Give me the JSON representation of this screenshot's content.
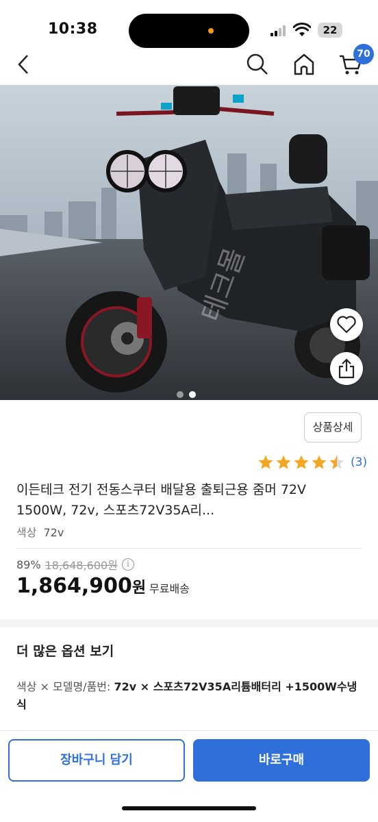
{
  "status_bar": {
    "time": "10:38",
    "battery": "22"
  },
  "nav": {
    "cart_count": "70"
  },
  "hero": {
    "watermark": "테크몰",
    "slide_count": 2,
    "active_slide": 2
  },
  "product": {
    "detail_button": "상품상세",
    "rating_stars": 4.5,
    "rating_count": "(3)",
    "title": "이든테크 전기 전동스쿠터 배달용 출퇴근용 줌머 72V 1500W, 72v, 스포츠72V35A리...",
    "color_label": "색상",
    "color_value": "72v",
    "discount": "89%",
    "original_price": "18,648,600원",
    "price": "1,864,900",
    "price_unit": "원",
    "shipping": "무료배송"
  },
  "options": {
    "title": "더 많은 옵션 보기",
    "summary_label": "색상 × 모델명/품번:",
    "summary_value": "72v × 스포츠72V35A리튬배터리 +1500W수냉식"
  },
  "actions": {
    "cart_button": "장바구니 담기",
    "buy_button": "바로구매"
  },
  "colors": {
    "accent": "#2e6fd9",
    "star": "#f5a623"
  }
}
